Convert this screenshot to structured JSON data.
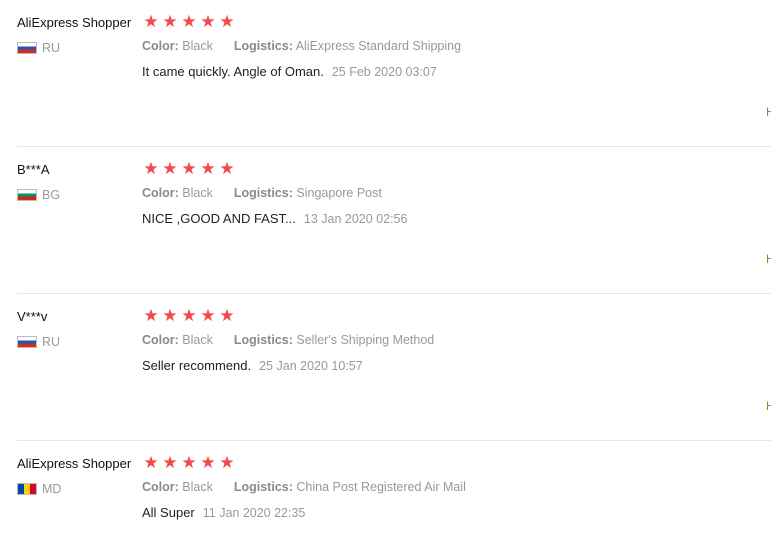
{
  "reviews": [
    {
      "name": "AliExpress Shopper",
      "country": "RU",
      "flag_icon": "flag-ru",
      "rating": 5,
      "color_label": "Color:",
      "color_value": "Black",
      "logistics_label": "Logistics:",
      "logistics_value": "AliExpress Standard Shipping",
      "text": "It came quickly. Angle of Oman.",
      "date": "25 Feb 2020 03:07"
    },
    {
      "name": "B***A",
      "country": "BG",
      "flag_icon": "flag-bg",
      "rating": 5,
      "color_label": "Color:",
      "color_value": "Black",
      "logistics_label": "Logistics:",
      "logistics_value": "Singapore Post",
      "text": "NICE ,GOOD AND FAST...",
      "date": "13 Jan 2020 02:56"
    },
    {
      "name": "V***v",
      "country": "RU",
      "flag_icon": "flag-ru",
      "rating": 5,
      "color_label": "Color:",
      "color_value": "Black",
      "logistics_label": "Logistics:",
      "logistics_value": "Seller's Shipping Method",
      "text": "Seller recommend.",
      "date": "25 Jan 2020 10:57"
    },
    {
      "name": "AliExpress Shopper",
      "country": "MD",
      "flag_icon": "flag-md",
      "rating": 5,
      "color_label": "Color:",
      "color_value": "Black",
      "logistics_label": "Logistics:",
      "logistics_value": "China Post Registered Air Mail",
      "text": "All Super",
      "date": "11 Jan 2020 22:35"
    }
  ],
  "helpful_label": "H",
  "colors": {
    "star": "#f04a4a",
    "helpful": "#6a9a2a",
    "divider": "#e6e6e6"
  }
}
